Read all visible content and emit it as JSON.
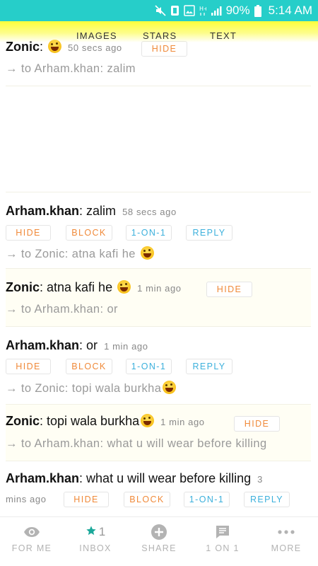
{
  "status_bar": {
    "battery": "90%",
    "time": "5:14 AM",
    "background_color": "#26cec9",
    "icons": [
      "mute-icon",
      "notification-icon",
      "image-icon",
      "h-plus-icon",
      "signal-icon",
      "battery-icon"
    ]
  },
  "tabs": [
    {
      "label": "IMAGES"
    },
    {
      "label": "STARS"
    },
    {
      "label": "TEXT"
    }
  ],
  "posts": [
    {
      "author": "Zonic",
      "message": "",
      "emoji": "laughing-face-icon",
      "time": "50 secs ago",
      "actions": [
        "HIDE"
      ],
      "reply_to": "→ to Arham.khan: zalim"
    },
    {
      "author": "Arham.khan",
      "message": "zalim",
      "time": "58 secs ago",
      "actions": [
        "HIDE",
        "BLOCK",
        "1-ON-1",
        "REPLY"
      ],
      "reply_to": "→ to Zonic: atna kafi he"
    },
    {
      "author": "Zonic",
      "message": "atna kafi he",
      "emoji": "laughing-face-icon",
      "time": "1 min ago",
      "actions": [
        "HIDE"
      ],
      "reply_to": "→ to Arham.khan: or"
    },
    {
      "author": "Arham.khan",
      "message": "or",
      "time": "1 min ago",
      "actions": [
        "HIDE",
        "BLOCK",
        "1-ON-1",
        "REPLY"
      ],
      "reply_to": "→ to Zonic: topi wala burkha"
    },
    {
      "author": "Zonic",
      "message": "topi wala burkha",
      "emoji": "laughing-face-icon",
      "time": "1 min ago",
      "actions": [
        "HIDE"
      ],
      "reply_to": "→ to Arham.khan: what u will wear before killing"
    },
    {
      "author": "Arham.khan",
      "message": "what u will wear before killing",
      "time_part1": "3",
      "time_part2": "mins ago",
      "actions": [
        "HIDE",
        "BLOCK",
        "1-ON-1",
        "REPLY"
      ]
    }
  ],
  "bottom_nav": [
    {
      "label": "FOR ME",
      "icon": "eye-icon"
    },
    {
      "label": "INBOX",
      "icon": "star-icon",
      "count": "1"
    },
    {
      "label": "SHARE",
      "icon": "plus-circle-icon"
    },
    {
      "label": "1 ON 1",
      "icon": "chat-icon"
    },
    {
      "label": "MORE",
      "icon": "more-dots-icon"
    }
  ],
  "colors": {
    "header_yellow": "#ffff3a",
    "action_orange": "#f08a3a",
    "action_blue": "#3cb0dc",
    "inbox_star": "#1ba89a"
  }
}
